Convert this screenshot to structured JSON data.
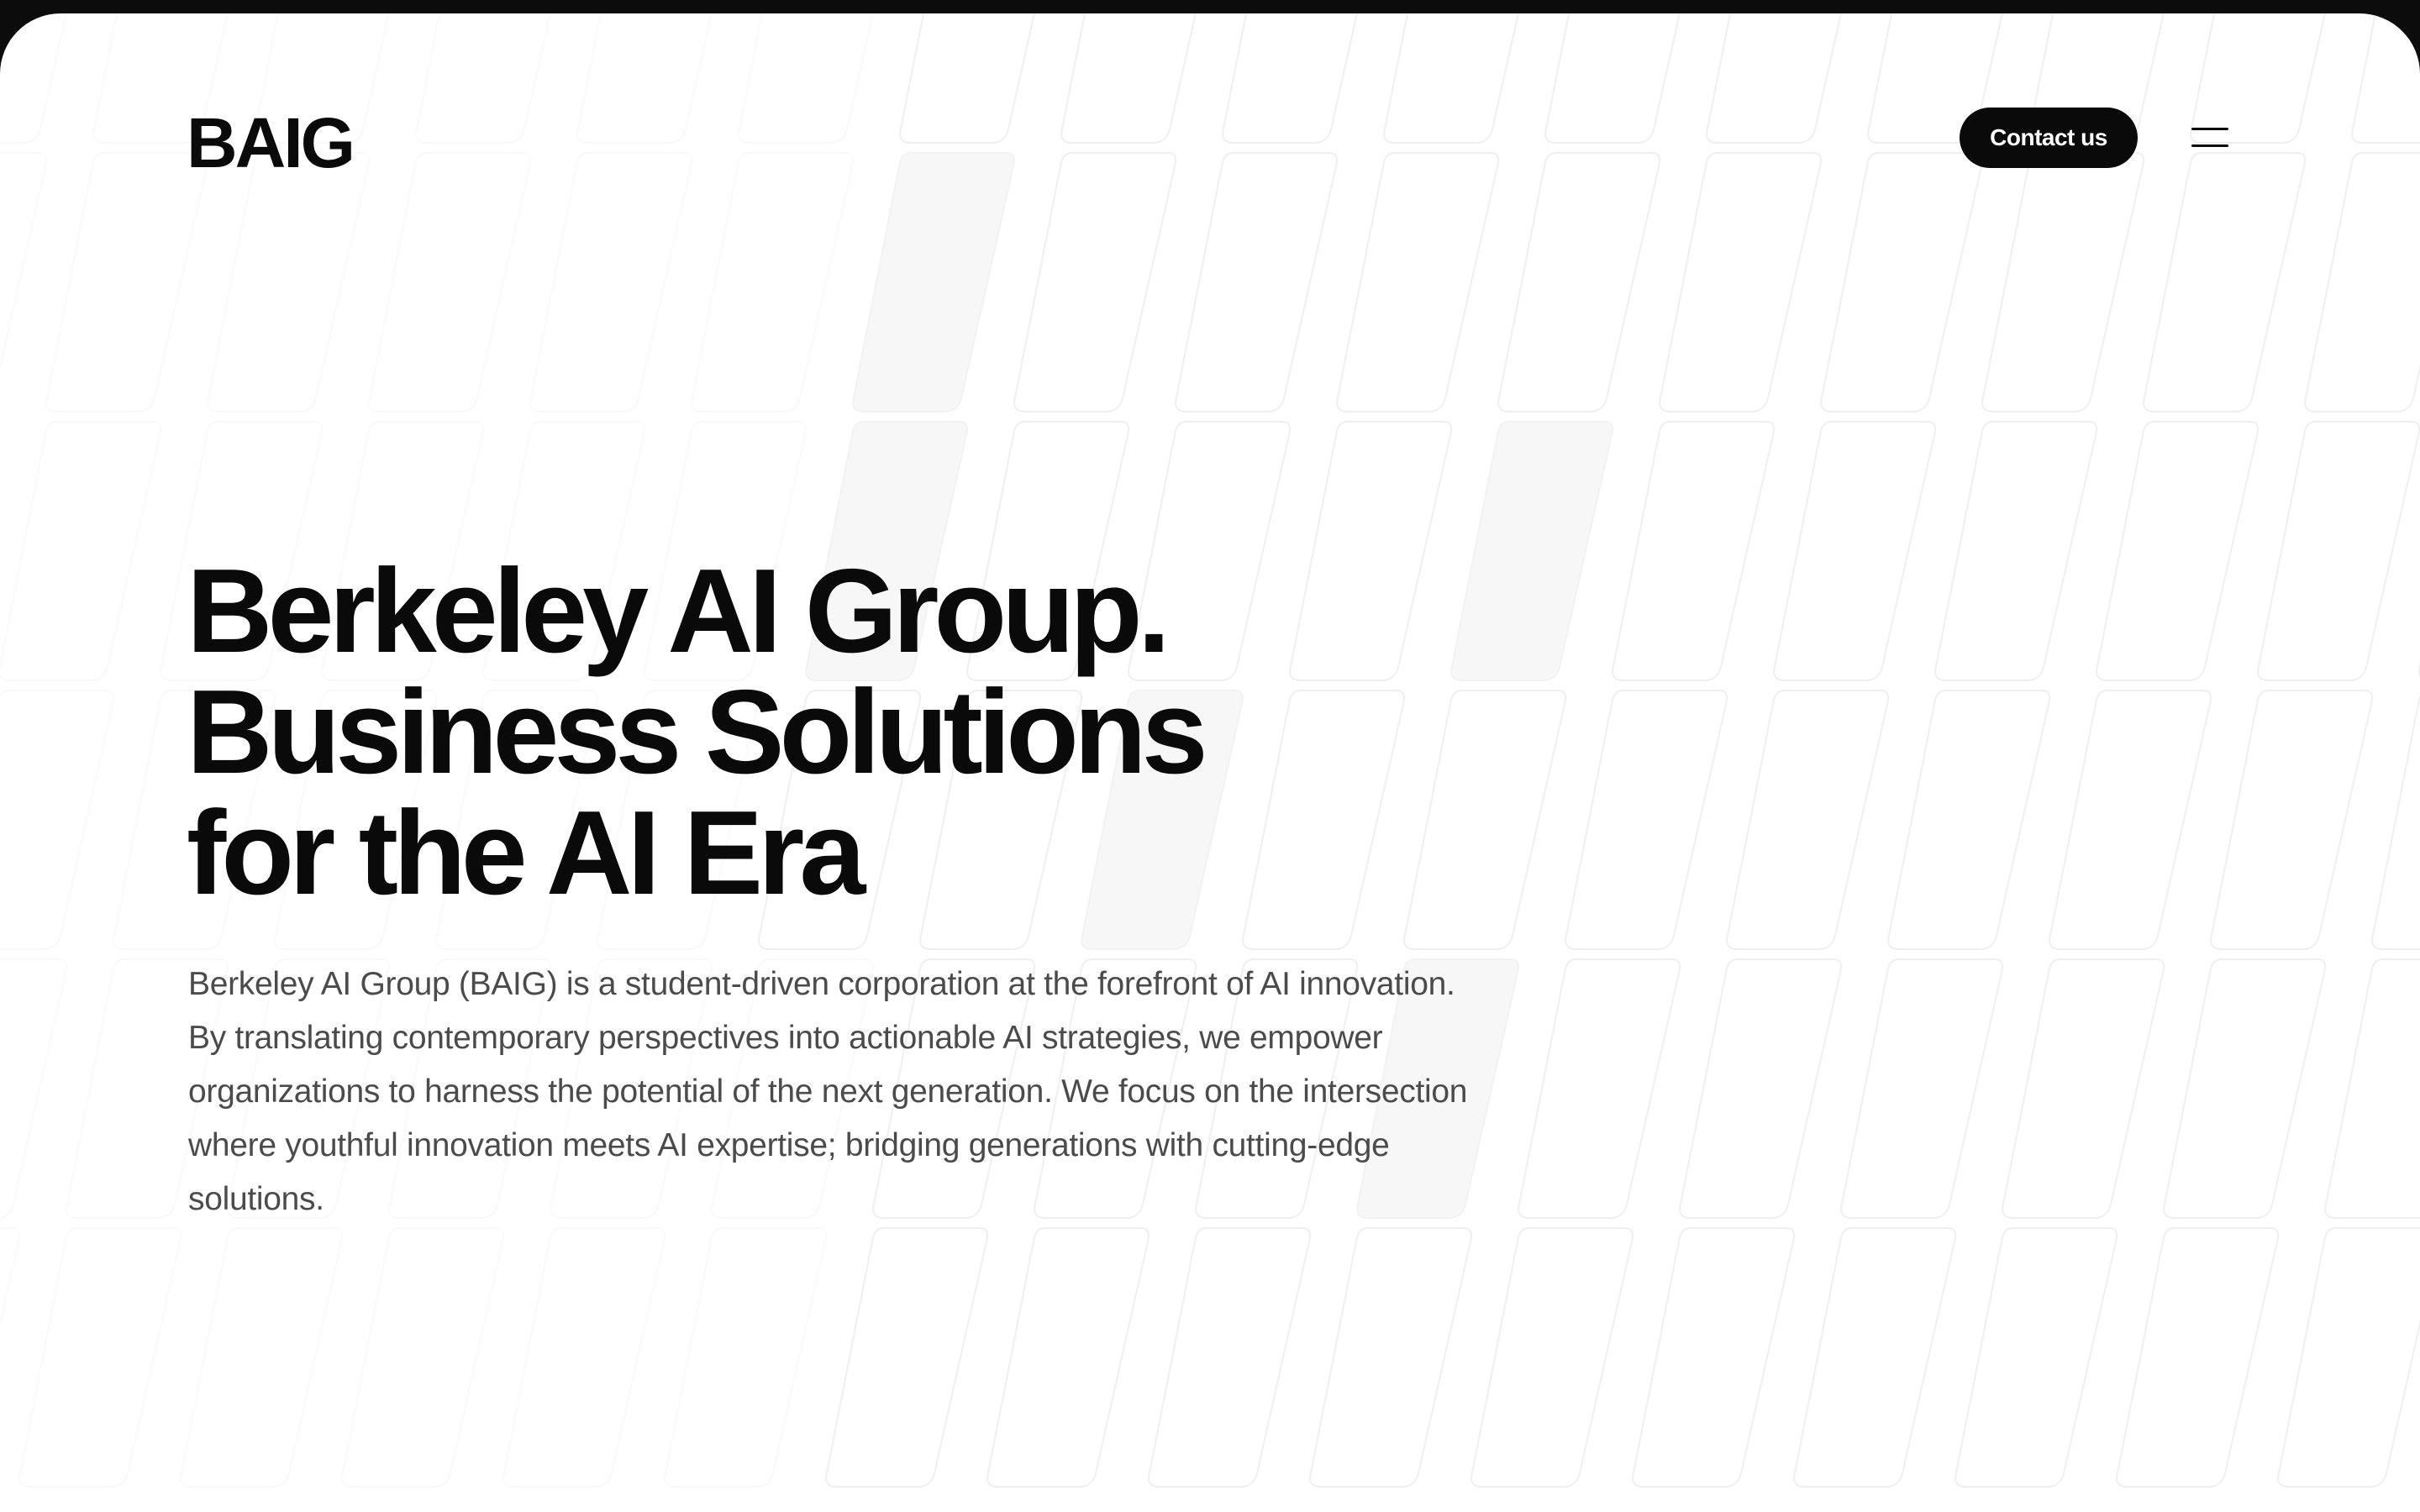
{
  "header": {
    "logo": "BAIG",
    "contact_label": "Contact us",
    "menu_icon": "hamburger-icon"
  },
  "hero": {
    "title_lines": [
      "Berkeley AI Group.",
      "Business Solutions",
      "for the AI Era"
    ],
    "description": "Berkeley AI Group (BAIG) is a student-driven corporation at the forefront of AI innovation. By translating contemporary perspectives into actionable AI strategies, we empower organizations to harness the potential of the next generation. We focus on the intersection where youthful innovation meets AI expertise; bridging generations with cutting-edge solutions."
  },
  "colors": {
    "background": "#ffffff",
    "frame": "#0c0c0c",
    "text_primary": "#0a0a0a",
    "text_secondary": "#4b4b4b",
    "button_bg": "#0a0a0a",
    "button_text": "#ffffff",
    "pattern_stroke": "#efefef",
    "pattern_fill": "#f7f7f7"
  }
}
